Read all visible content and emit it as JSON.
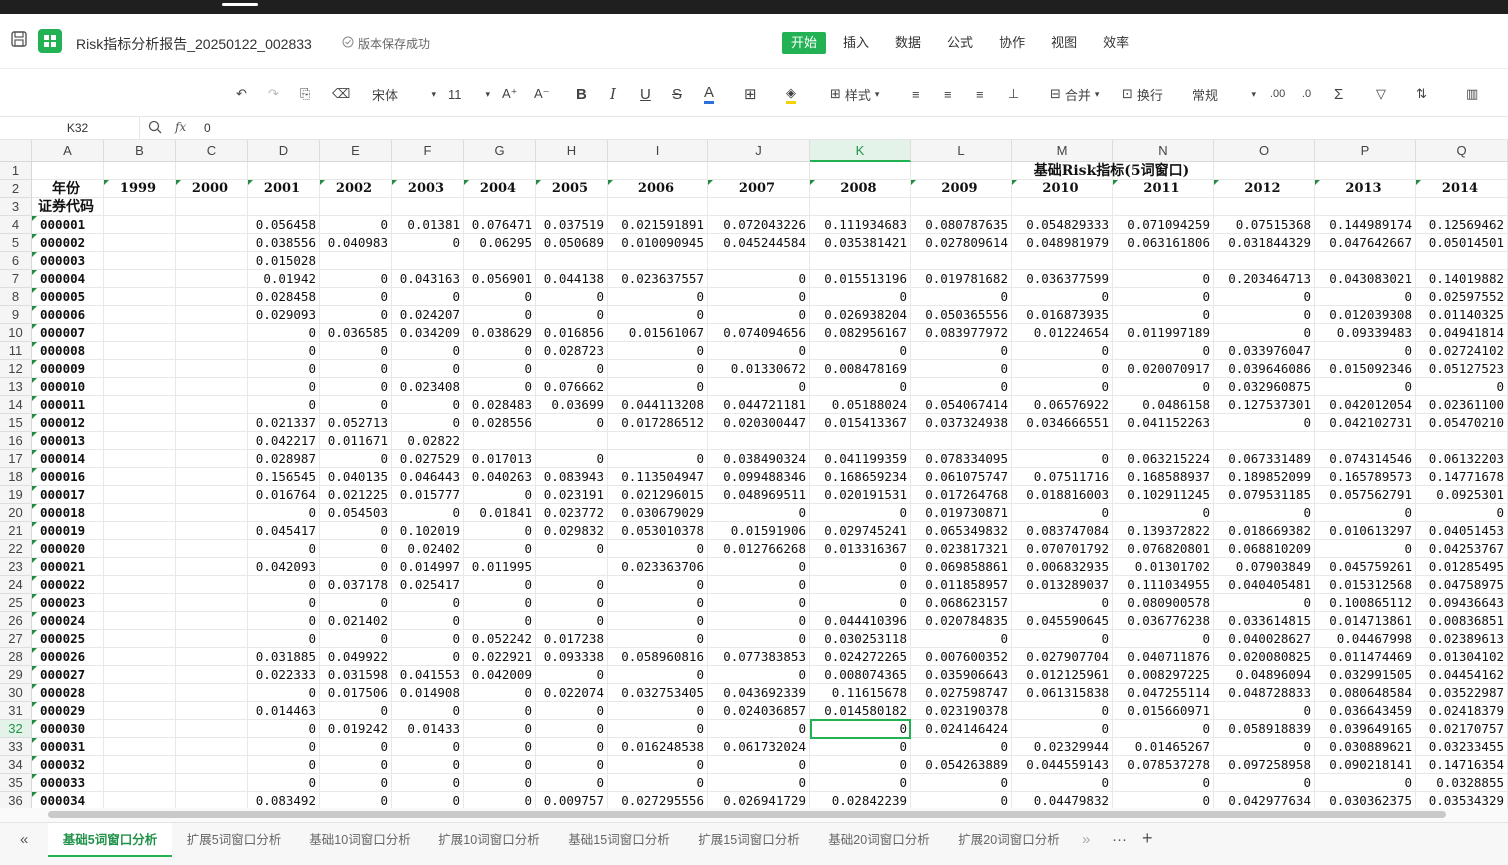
{
  "window": {
    "title": "Risk指标分析报告_20250122_002833",
    "save_status": "版本保存成功"
  },
  "menu": [
    "开始",
    "插入",
    "数据",
    "公式",
    "协作",
    "视图",
    "效率"
  ],
  "toolbar": {
    "font": "宋体",
    "size": "11",
    "style_label": "样式",
    "merge_label": "合并",
    "wrap_label": "换行",
    "format": "常规"
  },
  "formula_bar": {
    "cell_ref": "K32",
    "fx": "fx",
    "value": "0"
  },
  "columns": [
    "A",
    "B",
    "C",
    "D",
    "E",
    "F",
    "G",
    "H",
    "I",
    "J",
    "K",
    "L",
    "M",
    "N",
    "O",
    "P",
    "Q"
  ],
  "selected_column": "K",
  "row1_title": "基础Risk指标(5词窗口)",
  "row2": {
    "label": "年份",
    "years": [
      "1999",
      "2000",
      "2001",
      "2002",
      "2003",
      "2004",
      "2005",
      "2006",
      "2007",
      "2008",
      "2009",
      "2010",
      "2011",
      "2012",
      "2013",
      "2014"
    ]
  },
  "row3_label": "证券代码",
  "rows": [
    {
      "n": 4,
      "code": "000001",
      "v": [
        "",
        "",
        "0.056458",
        "0",
        "0.01381",
        "0.076471",
        "0.037519",
        "0.021591891",
        "0.072043226",
        "0.111934683",
        "0.080787635",
        "0.054829333",
        "0.071094259",
        "0.07515368",
        "0.144989174",
        "0.12569462"
      ]
    },
    {
      "n": 5,
      "code": "000002",
      "v": [
        "",
        "",
        "0.038556",
        "0.040983",
        "0",
        "0.06295",
        "0.050689",
        "0.010090945",
        "0.045244584",
        "0.035381421",
        "0.027809614",
        "0.048981979",
        "0.063161806",
        "0.031844329",
        "0.047642667",
        "0.05014501"
      ]
    },
    {
      "n": 6,
      "code": "000003",
      "v": [
        "",
        "",
        "0.015028",
        "",
        "",
        "",
        "",
        "",
        "",
        "",
        "",
        "",
        "",
        "",
        "",
        ""
      ]
    },
    {
      "n": 7,
      "code": "000004",
      "v": [
        "",
        "",
        "0.01942",
        "0",
        "0.043163",
        "0.056901",
        "0.044138",
        "0.023637557",
        "0",
        "0.015513196",
        "0.019781682",
        "0.036377599",
        "0",
        "0.203464713",
        "0.043083021",
        "0.14019882"
      ]
    },
    {
      "n": 8,
      "code": "000005",
      "v": [
        "",
        "",
        "0.028458",
        "0",
        "0",
        "0",
        "0",
        "0",
        "0",
        "0",
        "0",
        "0",
        "0",
        "0",
        "0",
        "0.02597552"
      ]
    },
    {
      "n": 9,
      "code": "000006",
      "v": [
        "",
        "",
        "0.029093",
        "0",
        "0.024207",
        "0",
        "0",
        "0",
        "0",
        "0.026938204",
        "0.050365556",
        "0.016873935",
        "0",
        "0",
        "0.012039308",
        "0.01140325"
      ]
    },
    {
      "n": 10,
      "code": "000007",
      "v": [
        "",
        "",
        "0",
        "0.036585",
        "0.034209",
        "0.038629",
        "0.016856",
        "0.01561067",
        "0.074094656",
        "0.082956167",
        "0.083977972",
        "0.01224654",
        "0.011997189",
        "0",
        "0.09339483",
        "0.04941814"
      ]
    },
    {
      "n": 11,
      "code": "000008",
      "v": [
        "",
        "",
        "0",
        "0",
        "0",
        "0",
        "0.028723",
        "0",
        "0",
        "0",
        "0",
        "0",
        "0",
        "0.033976047",
        "0",
        "0.02724102"
      ]
    },
    {
      "n": 12,
      "code": "000009",
      "v": [
        "",
        "",
        "0",
        "0",
        "0",
        "0",
        "0",
        "0",
        "0.01330672",
        "0.008478169",
        "0",
        "0",
        "0.020070917",
        "0.039646086",
        "0.015092346",
        "0.05127523"
      ]
    },
    {
      "n": 13,
      "code": "000010",
      "v": [
        "",
        "",
        "0",
        "0",
        "0.023408",
        "0",
        "0.076662",
        "0",
        "0",
        "0",
        "0",
        "0",
        "0",
        "0.032960875",
        "0",
        "0"
      ]
    },
    {
      "n": 14,
      "code": "000011",
      "v": [
        "",
        "",
        "0",
        "0",
        "0",
        "0.028483",
        "0.03699",
        "0.044113208",
        "0.044721181",
        "0.05188024",
        "0.054067414",
        "0.06576922",
        "0.0486158",
        "0.127537301",
        "0.042012054",
        "0.02361100"
      ]
    },
    {
      "n": 15,
      "code": "000012",
      "v": [
        "",
        "",
        "0.021337",
        "0.052713",
        "0",
        "0.028556",
        "0",
        "0.017286512",
        "0.020300447",
        "0.015413367",
        "0.037324938",
        "0.034666551",
        "0.041152263",
        "0",
        "0.042102731",
        "0.05470210"
      ]
    },
    {
      "n": 16,
      "code": "000013",
      "v": [
        "",
        "",
        "0.042217",
        "0.011671",
        "0.02822",
        "",
        "",
        "",
        "",
        "",
        "",
        "",
        "",
        "",
        "",
        ""
      ]
    },
    {
      "n": 17,
      "code": "000014",
      "v": [
        "",
        "",
        "0.028987",
        "0",
        "0.027529",
        "0.017013",
        "0",
        "0",
        "0.038490324",
        "0.041199359",
        "0.078334095",
        "0",
        "0.063215224",
        "0.067331489",
        "0.074314546",
        "0.06132203"
      ]
    },
    {
      "n": 18,
      "code": "000016",
      "v": [
        "",
        "",
        "0.156545",
        "0.040135",
        "0.046443",
        "0.040263",
        "0.083943",
        "0.113504947",
        "0.099488346",
        "0.168659234",
        "0.061075747",
        "0.07511716",
        "0.168588937",
        "0.189852099",
        "0.165789573",
        "0.14771678"
      ]
    },
    {
      "n": 19,
      "code": "000017",
      "v": [
        "",
        "",
        "0.016764",
        "0.021225",
        "0.015777",
        "0",
        "0.023191",
        "0.021296015",
        "0.048969511",
        "0.020191531",
        "0.017264768",
        "0.018816003",
        "0.102911245",
        "0.079531185",
        "0.057562791",
        "0.0925301"
      ]
    },
    {
      "n": 20,
      "code": "000018",
      "v": [
        "",
        "",
        "0",
        "0.054503",
        "0",
        "0.01841",
        "0.023772",
        "0.030679029",
        "0",
        "0",
        "0.019730871",
        "0",
        "0",
        "0",
        "0",
        "0"
      ]
    },
    {
      "n": 21,
      "code": "000019",
      "v": [
        "",
        "",
        "0.045417",
        "0",
        "0.102019",
        "0",
        "0.029832",
        "0.053010378",
        "0.01591906",
        "0.029745241",
        "0.065349832",
        "0.083747084",
        "0.139372822",
        "0.018669382",
        "0.010613297",
        "0.04051453"
      ]
    },
    {
      "n": 22,
      "code": "000020",
      "v": [
        "",
        "",
        "0",
        "0",
        "0.02402",
        "0",
        "0",
        "0",
        "0.012766268",
        "0.013316367",
        "0.023817321",
        "0.070701792",
        "0.076820801",
        "0.068810209",
        "0",
        "0.04253767"
      ]
    },
    {
      "n": 23,
      "code": "000021",
      "v": [
        "",
        "",
        "0.042093",
        "0",
        "0.014997",
        "0.011995",
        "",
        "0.023363706",
        "0",
        "0",
        "0.069858861",
        "0.006832935",
        "0.01301702",
        "0.07903849",
        "0.045759261",
        "0.01285495"
      ]
    },
    {
      "n": 24,
      "code": "000022",
      "v": [
        "",
        "",
        "0",
        "0.037178",
        "0.025417",
        "0",
        "0",
        "0",
        "0",
        "0",
        "0.011858957",
        "0.013289037",
        "0.111034955",
        "0.040405481",
        "0.015312568",
        "0.04758975"
      ]
    },
    {
      "n": 25,
      "code": "000023",
      "v": [
        "",
        "",
        "0",
        "0",
        "0",
        "0",
        "0",
        "0",
        "0",
        "0",
        "0.068623157",
        "0",
        "0.080900578",
        "0",
        "0.100865112",
        "0.09436643"
      ]
    },
    {
      "n": 26,
      "code": "000024",
      "v": [
        "",
        "",
        "0",
        "0.021402",
        "0",
        "0",
        "0",
        "0",
        "0",
        "0.044410396",
        "0.020784835",
        "0.045590645",
        "0.036776238",
        "0.033614815",
        "0.014713861",
        "0.00836851"
      ]
    },
    {
      "n": 27,
      "code": "000025",
      "v": [
        "",
        "",
        "0",
        "0",
        "0",
        "0.052242",
        "0.017238",
        "0",
        "0",
        "0.030253118",
        "0",
        "0",
        "0",
        "0.040028627",
        "0.04467998",
        "0.02389613"
      ]
    },
    {
      "n": 28,
      "code": "000026",
      "v": [
        "",
        "",
        "0.031885",
        "0.049922",
        "0",
        "0.022921",
        "0.093338",
        "0.058960816",
        "0.077383853",
        "0.024272265",
        "0.007600352",
        "0.027907704",
        "0.040711876",
        "0.020080825",
        "0.011474469",
        "0.01304102"
      ]
    },
    {
      "n": 29,
      "code": "000027",
      "v": [
        "",
        "",
        "0.022333",
        "0.031598",
        "0.041553",
        "0.042009",
        "0",
        "0",
        "0",
        "0.008074365",
        "0.035906643",
        "0.012125961",
        "0.008297225",
        "0.04896094",
        "0.032991505",
        "0.04454162"
      ]
    },
    {
      "n": 30,
      "code": "000028",
      "v": [
        "",
        "",
        "0",
        "0.017506",
        "0.014908",
        "0",
        "0.022074",
        "0.032753405",
        "0.043692339",
        "0.11615678",
        "0.027598747",
        "0.061315838",
        "0.047255114",
        "0.048728833",
        "0.080648584",
        "0.03522987"
      ]
    },
    {
      "n": 31,
      "code": "000029",
      "v": [
        "",
        "",
        "0.014463",
        "0",
        "0",
        "0",
        "0",
        "0",
        "0.024036857",
        "0.014580182",
        "0.023190378",
        "0",
        "0.015660971",
        "0",
        "0.036643459",
        "0.02418379"
      ]
    },
    {
      "n": 32,
      "code": "000030",
      "v": [
        "",
        "",
        "0",
        "0.019242",
        "0.01433",
        "0",
        "0",
        "0",
        "0",
        "0",
        "0.024146424",
        "0",
        "0",
        "0.058918839",
        "0.039649165",
        "0.02170757"
      ]
    },
    {
      "n": 33,
      "code": "000031",
      "v": [
        "",
        "",
        "0",
        "0",
        "0",
        "0",
        "0",
        "0.016248538",
        "0.061732024",
        "0",
        "0",
        "0.02329944",
        "0.01465267",
        "0",
        "0.030889621",
        "0.03233455"
      ]
    },
    {
      "n": 34,
      "code": "000032",
      "v": [
        "",
        "",
        "0",
        "0",
        "0",
        "0",
        "0",
        "0",
        "0",
        "0",
        "0.054263889",
        "0.044559143",
        "0.078537278",
        "0.097258958",
        "0.090218141",
        "0.14716354"
      ]
    },
    {
      "n": 35,
      "code": "000033",
      "v": [
        "",
        "",
        "0",
        "0",
        "0",
        "0",
        "0",
        "0",
        "0",
        "0",
        "0",
        "0",
        "0",
        "0",
        "0",
        "0.0328855"
      ]
    },
    {
      "n": 36,
      "code": "000034",
      "v": [
        "",
        "",
        "0.083492",
        "0",
        "0",
        "0",
        "0.009757",
        "0.027295556",
        "0.026941729",
        "0.02842239",
        "0",
        "0.04479832",
        "0",
        "0.042977634",
        "0.030362375",
        "0.03534329"
      ]
    }
  ],
  "sheets": [
    "基础5词窗口分析",
    "扩展5词窗口分析",
    "基础10词窗口分析",
    "扩展10词窗口分析",
    "基础15词窗口分析",
    "扩展15词窗口分析",
    "基础20词窗口分析",
    "扩展20词窗口分析"
  ],
  "sheet_nav": {
    "first": "«",
    "more": "»",
    "dots": "···",
    "add": "+"
  },
  "colors": {
    "accent": "#22b254",
    "header_bg": "#f5f5f5"
  }
}
